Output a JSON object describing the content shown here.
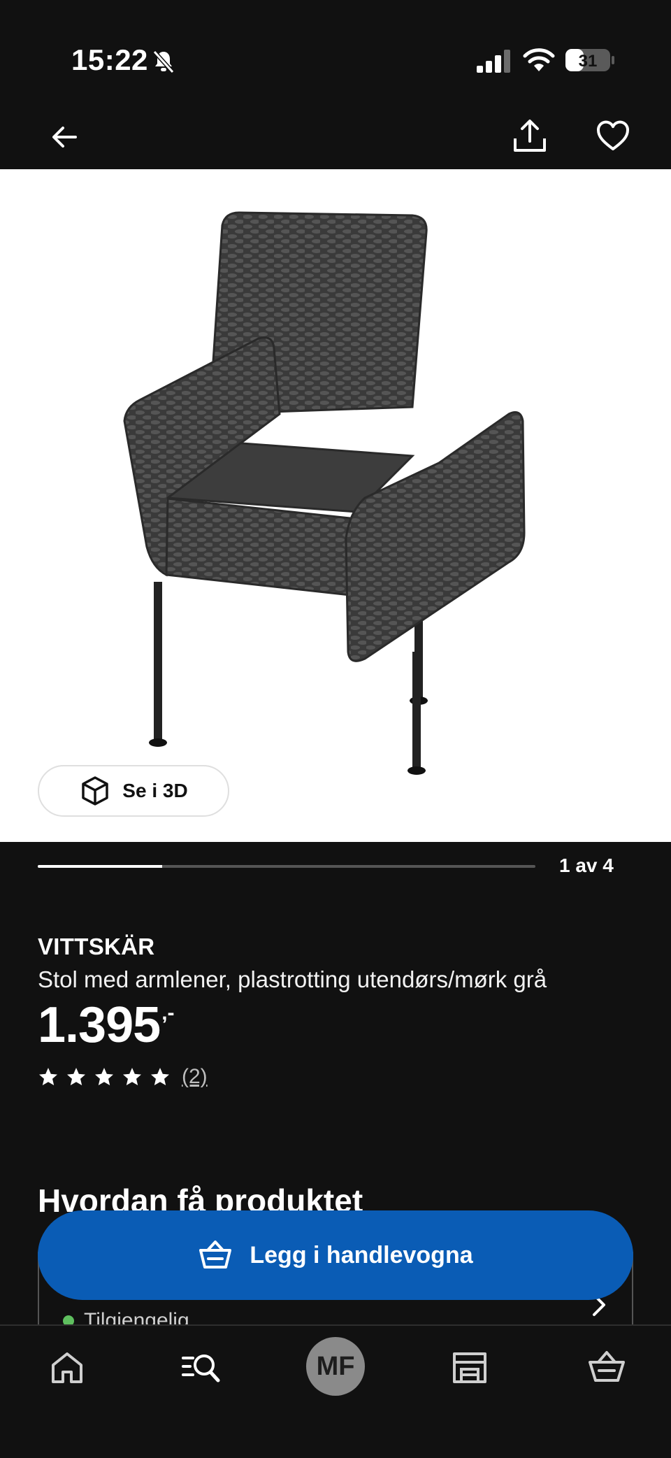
{
  "status_bar": {
    "time": "15:22",
    "battery": "31"
  },
  "product": {
    "name": "VITTSKÄR",
    "description": "Stol med armlener, plastrotting utendørs/mørk grå",
    "price": "1.395",
    "price_suffix": ",-",
    "rating": 5,
    "reviews": "(2)"
  },
  "gallery": {
    "counter": "1 av 4",
    "progress": 0.25,
    "view_3d_label": "Se i 3D"
  },
  "sections": {
    "how_to_get": "Hvordan få produktet",
    "availability": "Tilgjengelig"
  },
  "cart_button": {
    "label": "Legg i handlevogna"
  },
  "bottom_nav": {
    "avatar_initials": "MF"
  },
  "colors": {
    "accent": "#0a5cb5",
    "background": "#111111",
    "available": "#5fbf5f"
  }
}
